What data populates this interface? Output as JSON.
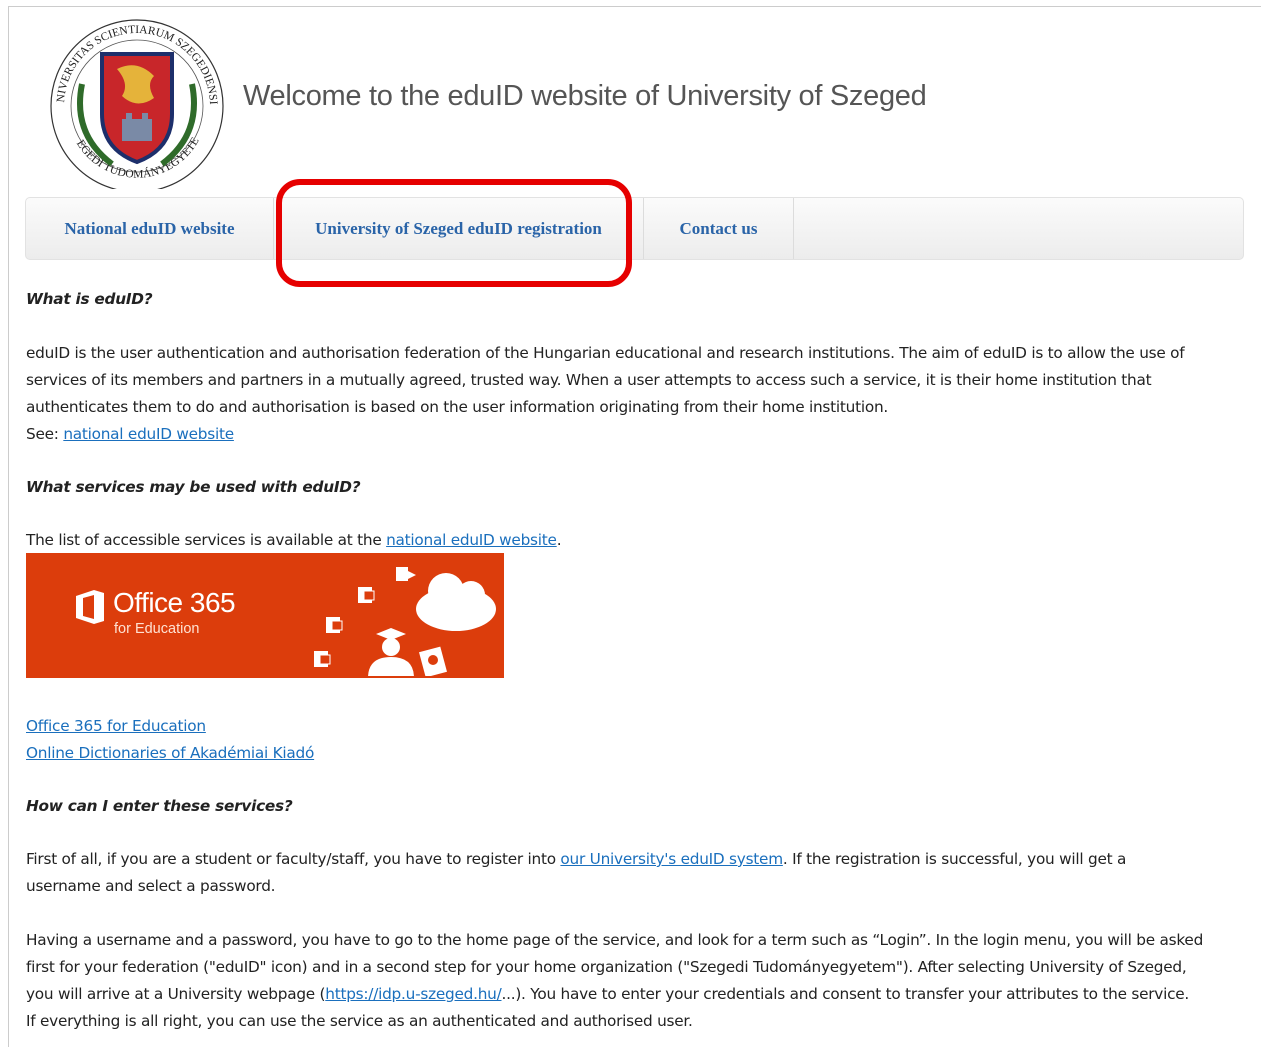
{
  "header": {
    "logo": {
      "icon": "university-seal-icon",
      "text_top": "UNIVERSITAS SCIENTIARUM SZEGEDIENSIS",
      "text_bottom": "SZEGEDI TUDOMÁNYEGYETEM"
    },
    "welcome_title": "Welcome to the eduID website of University of Szeged"
  },
  "nav": {
    "items": [
      {
        "label": "National eduID website"
      },
      {
        "label": "University of Szeged eduID registration"
      },
      {
        "label": "Contact us"
      }
    ],
    "highlight_color": "#e60000",
    "link_color": "#2a64a8"
  },
  "content": {
    "q1": "What is eduID?",
    "p1_lines": [
      "eduID is the user authentication and authorisation federation of the Hungarian educational and research institutions. The aim of eduID is to allow the use of",
      "services of its members and partners in a mutually agreed, trusted way. When a user attempts to access such a service, it is their home institution that",
      "authenticates them to do and authorisation is based on the user information originating from their home institution."
    ],
    "see_prefix": "See: ",
    "see_link": "national eduID website",
    "q2": "What services may be used with eduID?",
    "list_prefix": "The list of accessible services is available at the ",
    "list_link": "national eduID website",
    "list_suffix": ".",
    "banner": {
      "title": "Office 365",
      "subtitle": "for Education",
      "background": "#dc3d0c",
      "icons": [
        "office-logo-icon",
        "excel-icon",
        "word-icon",
        "lync-icon",
        "exchange-icon",
        "cloud-icon",
        "student-icon",
        "certificate-icon"
      ]
    },
    "service_links": [
      "Office 365 for Education",
      "Online Dictionaries of Akadémiai Kiadó"
    ],
    "q3": "How can I enter these services?",
    "p2_before": "First of all, if you are a student or faculty/staff, you have to register into ",
    "p2_link": "our University's eduID system",
    "p2_after": ". If the registration is successful, you will get a",
    "p2_line2": "username and select a password.",
    "p3_line1": "Having a username and a password, you have to go to the home page of the service, and look for a term such as “Login”. In the login menu, you will be asked",
    "p3_line2": "first for your federation (\"eduID\" icon) and in a second step for your home organization (\"Szegedi Tudományegyetem\"). After selecting University of Szeged,",
    "p3_line3_before": "you will arrive at a University webpage (",
    "p3_line3_link": "https://idp.u-szeged.hu/",
    "p3_line3_after": "...). You have to enter your credentials and consent to transfer your attributes to the service.",
    "p3_line4": "If everything is all right, you can use the service as an authenticated and authorised user.",
    "link_color": "#1a6fbd"
  }
}
